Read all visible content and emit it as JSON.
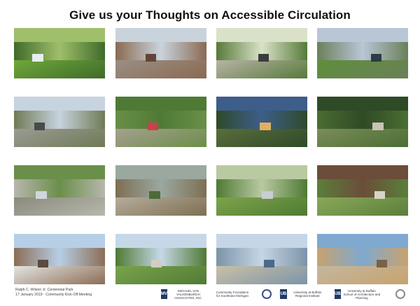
{
  "title": "Give us your Thoughts on Accessible Circulation",
  "footer": {
    "line1": "Ralph C. Wilson Jr. Centennial Park",
    "line2": "17 January 2019 - Community Kick-Off Meeting"
  },
  "logos": [
    {
      "name": "mvvainc-logo",
      "mark": "MV",
      "text": "MICHAEL VAN VALKENBURGH ASSOCIATES, INC."
    },
    {
      "name": "community-foundation-logo",
      "mark": "",
      "text": "Community Foundation for Southeast Michigan"
    },
    {
      "name": "university-seal-logo",
      "mark": "",
      "text": ""
    },
    {
      "name": "regional-institute-logo",
      "mark": "UB",
      "text": "University at Buffalo Regional Institute"
    },
    {
      "name": "school-of-architecture-logo",
      "mark": "UB",
      "text": "University at Buffalo School of Architecture and Planning"
    },
    {
      "name": "partner-logo",
      "mark": "",
      "text": ""
    }
  ],
  "photos": [
    {
      "sky": "#9fbf6a",
      "mid": "#3f6b2a",
      "ground": "#6fa83a",
      "accent": "#e8edf2"
    },
    {
      "sky": "#c9d3dc",
      "mid": "#8a6a52",
      "ground": "#9a8f84",
      "accent": "#5f4638"
    },
    {
      "sky": "#d9e2c8",
      "mid": "#577a3a",
      "ground": "#b8b3a6",
      "accent": "#3b3b3b"
    },
    {
      "sky": "#b8c6d6",
      "mid": "#6b7f5a",
      "ground": "#5f8f3a",
      "accent": "#2e3a48"
    },
    {
      "sky": "#c7d3df",
      "mid": "#6f7b55",
      "ground": "#9a9a94",
      "accent": "#4a4a4a"
    },
    {
      "sky": "#4f7a35",
      "mid": "#6a8f47",
      "ground": "#a69f90",
      "accent": "#c8424a"
    },
    {
      "sky": "#3d5e8a",
      "mid": "#2e4a2a",
      "ground": "#5a6e3a",
      "accent": "#e0b060"
    },
    {
      "sky": "#2f4a26",
      "mid": "#4a6e32",
      "ground": "#7c8c5a",
      "accent": "#c9c3b8"
    },
    {
      "sky": "#6a8f4a",
      "mid": "#b7b7ad",
      "ground": "#8a8a7c",
      "accent": "#cfd6dd"
    },
    {
      "sky": "#9aa8a0",
      "mid": "#7e6f52",
      "ground": "#b5ac9c",
      "accent": "#4d6b3a"
    },
    {
      "sky": "#b9c9a2",
      "mid": "#4f7a34",
      "ground": "#7da44a",
      "accent": "#c7cdd3"
    },
    {
      "sky": "#6b4d3a",
      "mid": "#5a7f3a",
      "ground": "#8aa85a",
      "accent": "#d8d3c7"
    },
    {
      "sky": "#b6cfe6",
      "mid": "#8c6d55",
      "ground": "#e3e4e2",
      "accent": "#5a4b3e"
    },
    {
      "sky": "#c6d8e8",
      "mid": "#4f7a34",
      "ground": "#7aa44c",
      "accent": "#d3cdc0"
    },
    {
      "sky": "#c5d6e6",
      "mid": "#7c94a8",
      "ground": "#c9c0a6",
      "accent": "#4a6a8a"
    },
    {
      "sky": "#7fa9cf",
      "mid": "#c7a36e",
      "ground": "#c3b79e",
      "accent": "#7a6148"
    }
  ]
}
